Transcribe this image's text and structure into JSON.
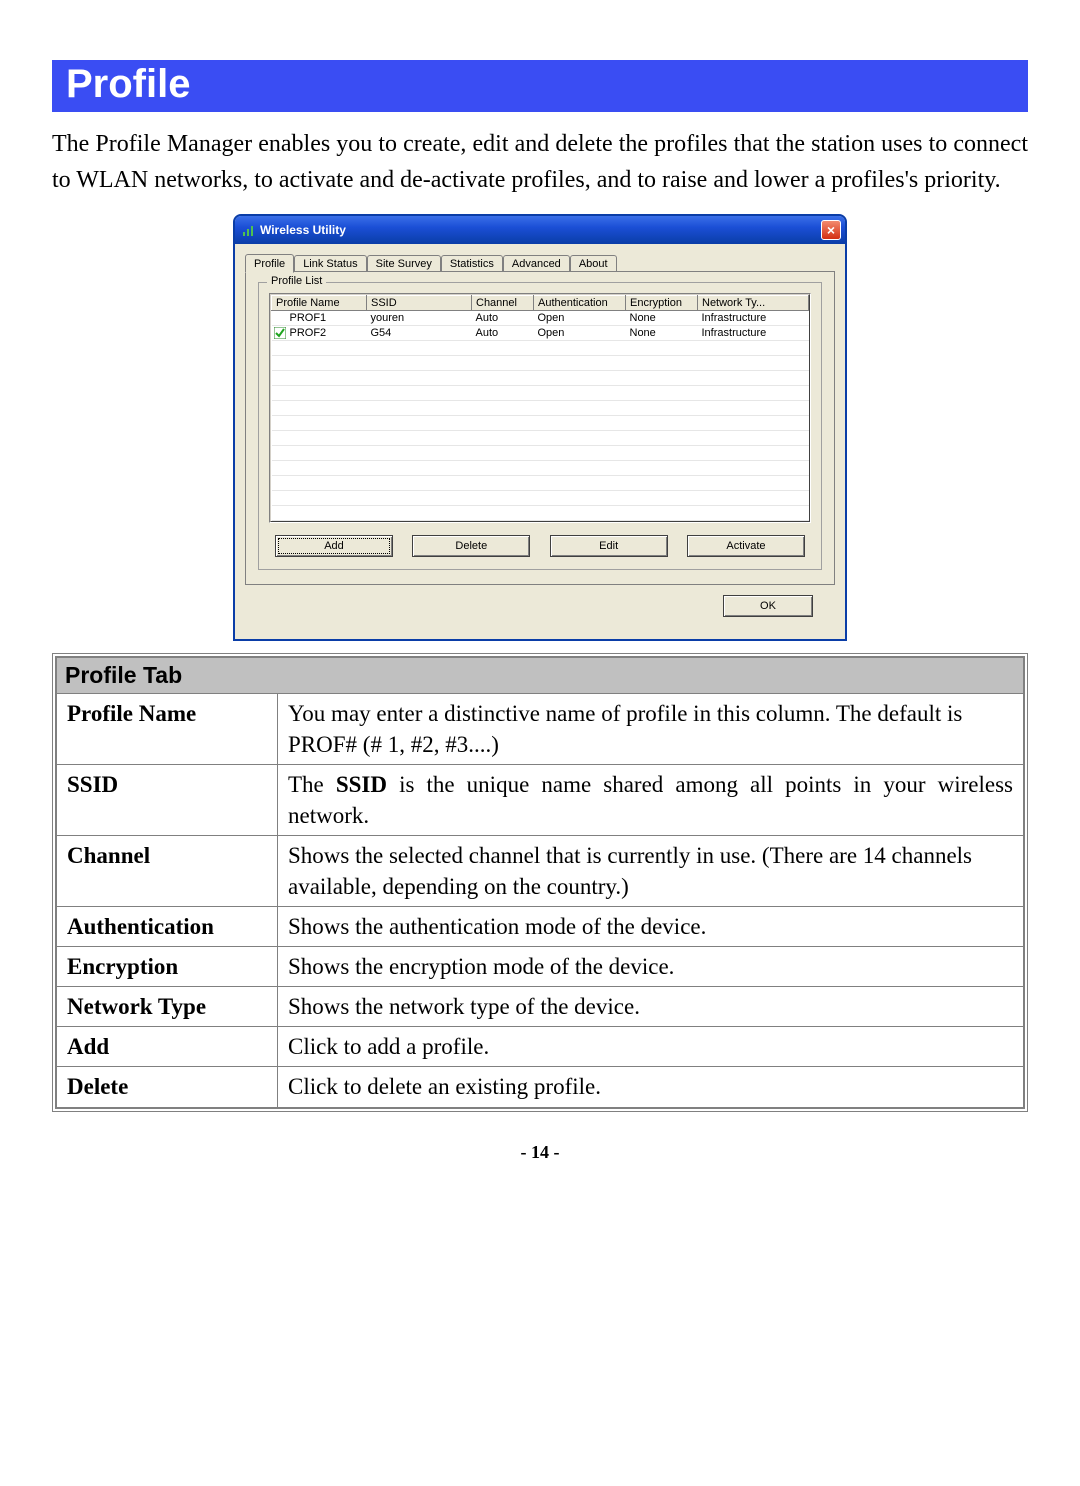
{
  "heading": "Profile",
  "intro": "The Profile Manager enables you to create, edit and delete the profiles that the station uses to connect to WLAN networks, to activate and de-activate profiles, and to raise and lower a profiles's priority.",
  "window": {
    "title": "Wireless Utility",
    "close": "×",
    "tabs": [
      "Profile",
      "Link Status",
      "Site Survey",
      "Statistics",
      "Advanced",
      "About"
    ],
    "group_legend": "Profile List",
    "columns": [
      "Profile Name",
      "SSID",
      "Channel",
      "Authentication",
      "Encryption",
      "Network Ty..."
    ],
    "rows": [
      {
        "checked": false,
        "cells": [
          "PROF1",
          "youren",
          "Auto",
          "Open",
          "None",
          "Infrastructure"
        ]
      },
      {
        "checked": true,
        "cells": [
          "PROF2",
          "G54",
          "Auto",
          "Open",
          "None",
          "Infrastructure"
        ]
      }
    ],
    "buttons": [
      "Add",
      "Delete",
      "Edit",
      "Activate"
    ],
    "ok": "OK"
  },
  "desc": {
    "header": "Profile Tab",
    "rows": [
      {
        "label": "Profile Name",
        "text_pre": "You may enter a distinctive name of profile in this column. The default is PROF# (# 1, #2, #3....)"
      },
      {
        "label": "SSID",
        "ssid_lead": "The ",
        "ssid_bold": "SSID",
        "ssid_rest": " is the unique name shared among all points in your wireless network."
      },
      {
        "label": "Channel",
        "text_pre": "Shows the selected channel that is currently in use. (There are 14 channels available, depending on the country.)"
      },
      {
        "label": "Authentication",
        "text_pre": "Shows the authentication mode of the device."
      },
      {
        "label": "Encryption",
        "text_pre": "Shows the encryption mode of the device."
      },
      {
        "label": "Network Type",
        "text_pre": "Shows the network type of the device."
      },
      {
        "label": "Add",
        "text_pre": "Click to add a profile."
      },
      {
        "label": "Delete",
        "text_pre": "Click to delete an existing profile."
      }
    ]
  },
  "pagenum": "- 14 -"
}
